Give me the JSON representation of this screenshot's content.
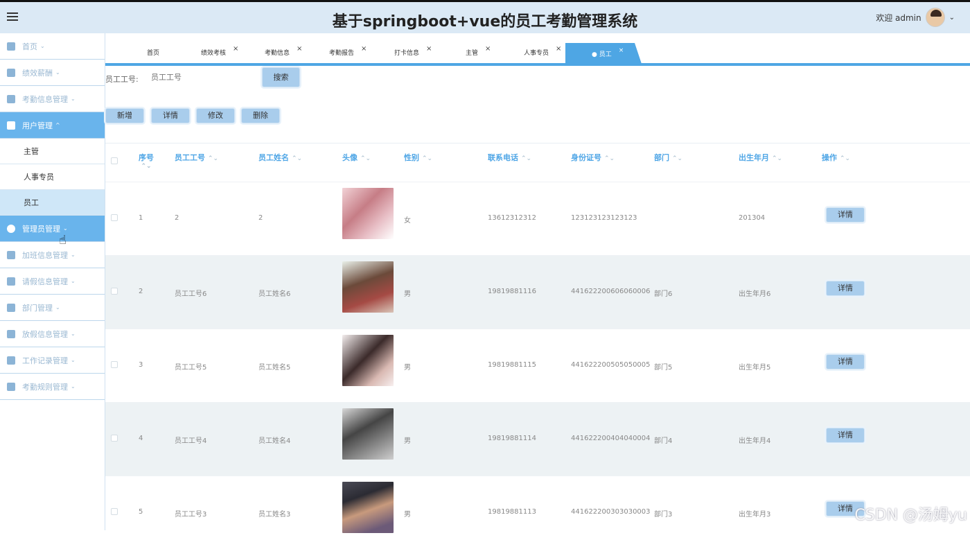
{
  "header": {
    "title": "基于springboot+vue的员工考勤管理系统",
    "welcome": "欢迎 admin"
  },
  "sidebar": {
    "items": [
      {
        "label": "首页",
        "icon": "home-icon",
        "active": false
      },
      {
        "label": "绩效薪酬",
        "icon": "document-icon",
        "active": false
      },
      {
        "label": "考勤信息管理",
        "icon": "grid-icon",
        "active": false
      },
      {
        "label": "用户管理",
        "icon": "user-icon",
        "active": true,
        "chev": "^"
      },
      {
        "label": "管理员管理",
        "icon": "circle-icon",
        "active": true
      },
      {
        "label": "加班信息管理",
        "icon": "dashboard-icon",
        "active": false
      },
      {
        "label": "请假信息管理",
        "icon": "card-icon",
        "active": false
      },
      {
        "label": "部门管理",
        "icon": "apps-icon",
        "active": false
      },
      {
        "label": "放假信息管理",
        "icon": "calendar-icon",
        "active": false
      },
      {
        "label": "工作记录管理",
        "icon": "record-icon",
        "active": false
      },
      {
        "label": "考勤规则管理",
        "icon": "mail-icon",
        "active": false
      }
    ],
    "subitems": [
      "主管",
      "人事专员",
      "员工"
    ]
  },
  "tabs": [
    {
      "label": "首页"
    },
    {
      "label": "绩效考核"
    },
    {
      "label": "考勤信息"
    },
    {
      "label": "考勤报告"
    },
    {
      "label": "打卡信息"
    },
    {
      "label": "主管"
    },
    {
      "label": "人事专员"
    },
    {
      "label": "● 员工"
    }
  ],
  "search": {
    "label": "员工工号:",
    "placeholder": "员工工号",
    "button": "搜索"
  },
  "actions": {
    "add": "新增",
    "detail": "详情",
    "edit": "修改",
    "delete": "删除"
  },
  "table": {
    "headers": [
      "序号",
      "员工工号",
      "员工姓名",
      "头像",
      "性别",
      "联系电话",
      "身份证号",
      "部门",
      "出生年月",
      "操作"
    ],
    "rows": [
      {
        "no": "1",
        "id": "2",
        "name": "2",
        "gender": "女",
        "phone": "13612312312",
        "idcard": "123123123123123",
        "dept": "",
        "birth": "201304",
        "btn": "详情"
      },
      {
        "no": "2",
        "id": "员工工号6",
        "name": "员工姓名6",
        "gender": "男",
        "phone": "19819881116",
        "idcard": "441622200606060006",
        "dept": "部门6",
        "birth": "出生年月6",
        "btn": "详情"
      },
      {
        "no": "3",
        "id": "员工工号5",
        "name": "员工姓名5",
        "gender": "男",
        "phone": "19819881115",
        "idcard": "441622200505050005",
        "dept": "部门5",
        "birth": "出生年月5",
        "btn": "详情"
      },
      {
        "no": "4",
        "id": "员工工号4",
        "name": "员工姓名4",
        "gender": "男",
        "phone": "19819881114",
        "idcard": "441622200404040004",
        "dept": "部门4",
        "birth": "出生年月4",
        "btn": "详情"
      },
      {
        "no": "5",
        "id": "员工工号3",
        "name": "员工姓名3",
        "gender": "男",
        "phone": "19819881113",
        "idcard": "441622200303030003",
        "dept": "部门3",
        "birth": "出生年月3",
        "btn": "详情"
      }
    ]
  },
  "watermark": "CSDN @汤姆yu",
  "colors": {
    "accent": "#4ea6e4",
    "header_bg": "#dbe9f5",
    "active_nav": "#69b4ec",
    "button": "#a9cdec"
  }
}
